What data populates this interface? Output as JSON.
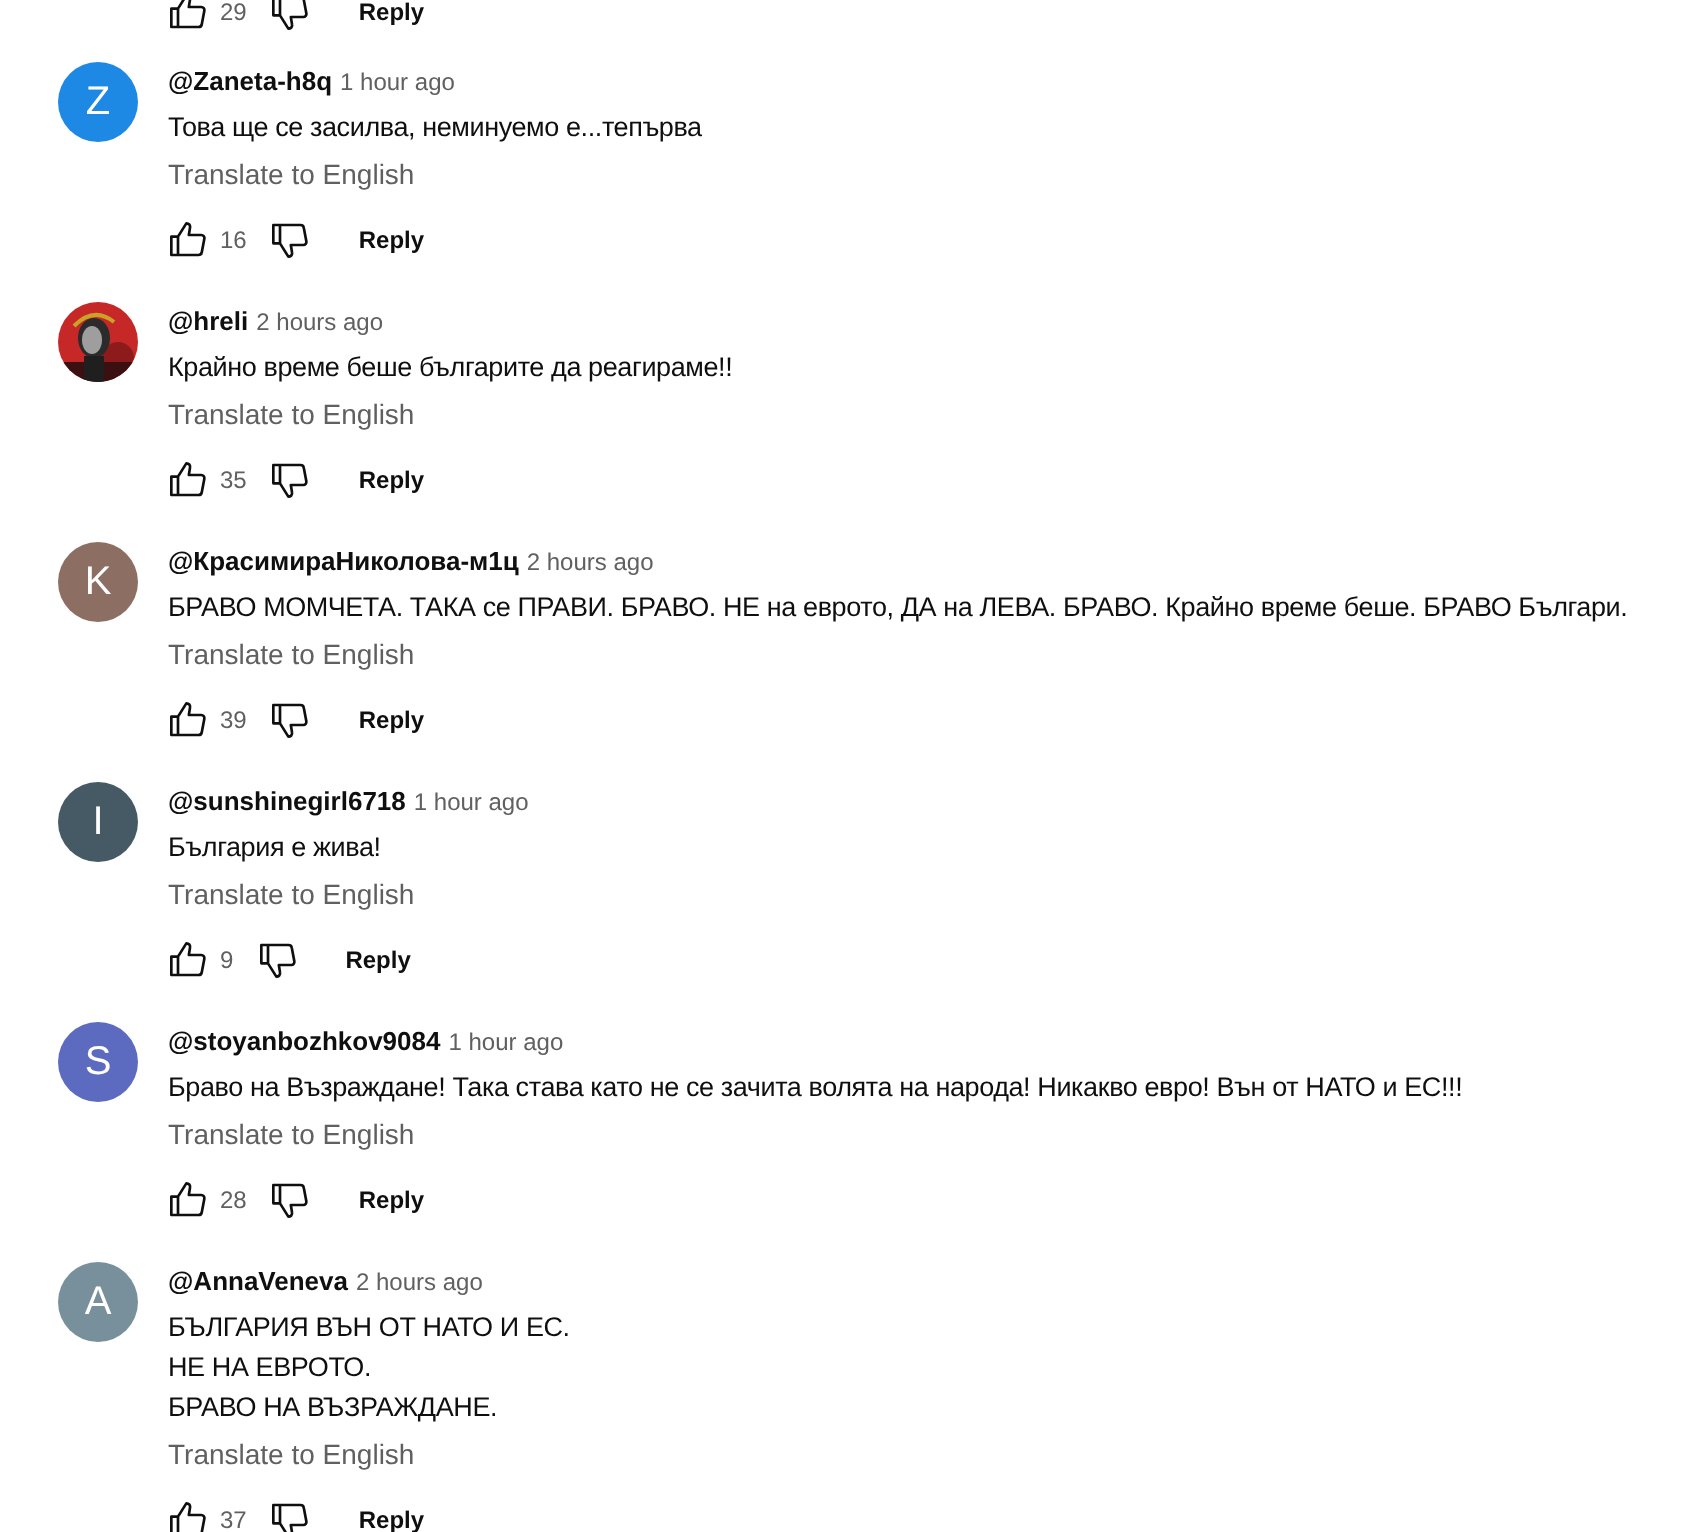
{
  "partial_actions": {
    "likes": "29",
    "reply": "Reply"
  },
  "comments": [
    {
      "author": "@Zaneta-h8q",
      "time": "1 hour ago",
      "avatar": {
        "kind": "letter",
        "letter": "Z",
        "color": "#1e88e5"
      },
      "lines": [
        "Това ще се засилва, неминуемо е...тепърва"
      ],
      "translate": "Translate to English",
      "likes": "16",
      "reply": "Reply"
    },
    {
      "author": "@hreli",
      "time": "2 hours ago",
      "lines": [
        "Крайно време беше българите да реагираме!!"
      ],
      "translate": "Translate to English",
      "likes": "35",
      "reply": "Reply"
    },
    {
      "author": "@КрасимираНиколова-м1ц",
      "time": "2 hours ago",
      "avatar": {
        "kind": "letter",
        "letter": "K",
        "color": "#8d6e63"
      },
      "lines": [
        "БРАВО МОМЧЕТА. ТАКА се ПРАВИ. БРАВО. НЕ на еврото, ДА на ЛЕВА. БРАВО. Крайно време беше. БРАВО Българи."
      ],
      "translate": "Translate to English",
      "likes": "39",
      "reply": "Reply"
    },
    {
      "author": "@sunshinegirl6718",
      "time": "1 hour ago",
      "avatar": {
        "kind": "letter",
        "letter": "I",
        "color": "#455a64"
      },
      "lines": [
        "България е жива!"
      ],
      "translate": "Translate to English",
      "likes": "9",
      "reply": "Reply"
    },
    {
      "author": "@stoyanbozhkov9084",
      "time": "1 hour ago",
      "avatar": {
        "kind": "letter",
        "letter": "S",
        "color": "#5c6bc0"
      },
      "lines": [
        "Браво на Възраждане! Така става като не се зачита волята на народа! Никакво евро! Вън от НАТО и ЕС!!!"
      ],
      "translate": "Translate to English",
      "likes": "28",
      "reply": "Reply"
    },
    {
      "author": "@AnnaVeneva",
      "time": "2 hours ago",
      "avatar": {
        "kind": "letter",
        "letter": "A",
        "color": "#78909c"
      },
      "lines": [
        "БЪЛГАРИЯ ВЪН ОТ НАТО И ЕС.",
        "НЕ НА ЕВРОТО.",
        "БРАВО НА ВЪЗРАЖДАНЕ."
      ],
      "translate": "Translate to English",
      "likes": "37",
      "reply": "Reply"
    }
  ]
}
